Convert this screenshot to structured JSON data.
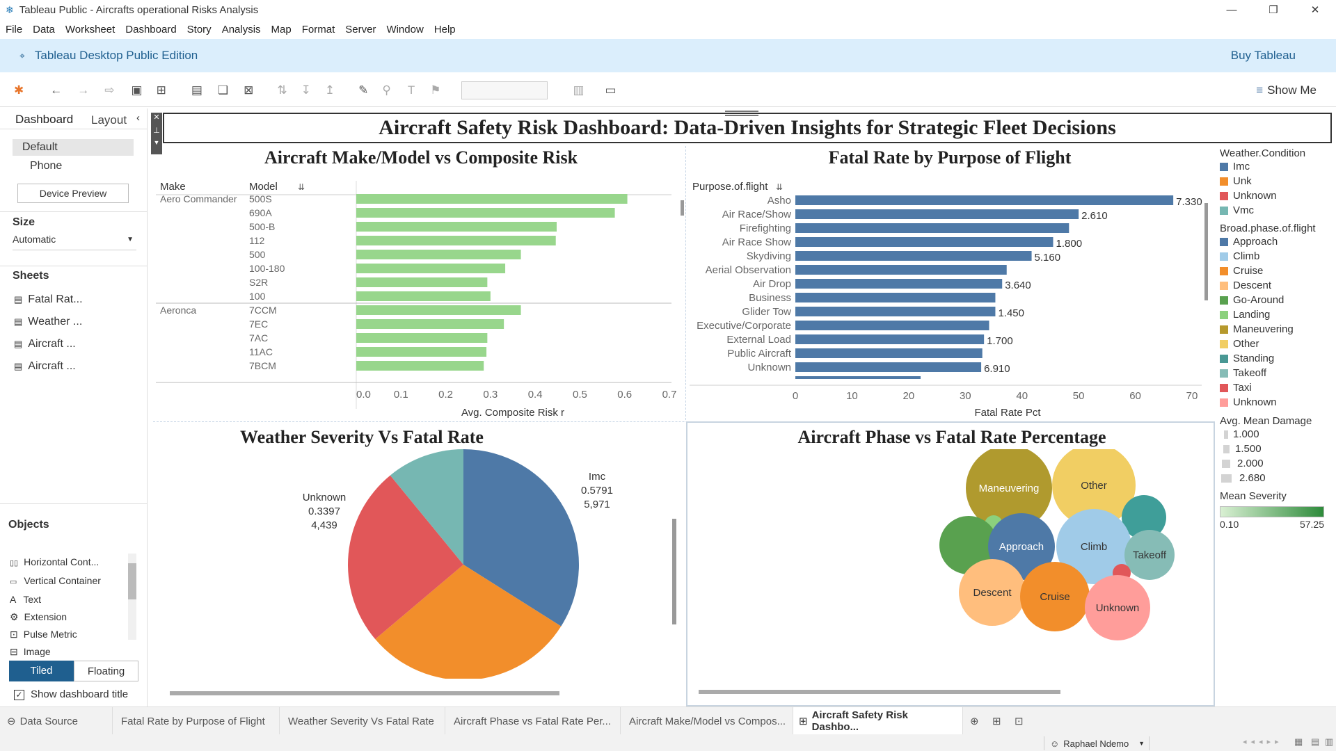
{
  "window": {
    "title": "Tableau Public - Aircrafts operational Risks Analysis",
    "controls": [
      "—",
      "❐",
      "✕"
    ]
  },
  "menu": [
    "File",
    "Data",
    "Worksheet",
    "Dashboard",
    "Story",
    "Analysis",
    "Map",
    "Format",
    "Server",
    "Window",
    "Help"
  ],
  "edition": {
    "label": "Tableau Desktop Public Edition",
    "buy": "Buy Tableau"
  },
  "toolbar": {
    "show_me": "Show Me"
  },
  "left": {
    "tabs": {
      "dashboard": "Dashboard",
      "layout": "Layout"
    },
    "devices": [
      "Default",
      "Phone"
    ],
    "device_preview": "Device Preview",
    "size_title": "Size",
    "size_value": "Automatic",
    "sheets_title": "Sheets",
    "sheets": [
      "Fatal Rat...",
      "Weather ...",
      "Aircraft ...",
      "Aircraft ..."
    ],
    "objects_title": "Objects",
    "objects": [
      "Horizontal Cont...",
      "Vertical Container",
      "Text",
      "Extension",
      "Pulse Metric",
      "Image"
    ],
    "tiled": "Tiled",
    "floating": "Floating",
    "show_title": "Show dashboard title"
  },
  "dashboard": {
    "title": "Aircraft Safety Risk Dashboard: Data-Driven Insights for Strategic Fleet Decisions"
  },
  "chart_data": [
    {
      "type": "bar",
      "title": "Aircraft Make/Model vs Composite Risk",
      "header_make": "Make",
      "header_model": "Model",
      "xlabel": "Avg. Composite Risk r",
      "xlim": [
        0,
        0.7
      ],
      "xticks": [
        "0.0",
        "0.1",
        "0.2",
        "0.3",
        "0.4",
        "0.5",
        "0.6",
        "0.7"
      ],
      "groups": [
        {
          "make": "Aero Commander",
          "models": [
            "500S",
            "690A",
            "500-B",
            "112",
            "500",
            "100-180",
            "S2R",
            "100"
          ],
          "values": [
            0.606,
            0.578,
            0.448,
            0.446,
            0.368,
            0.333,
            0.293,
            0.3
          ]
        },
        {
          "make": "Aeronca",
          "models": [
            "7CCM",
            "7EC",
            "7AC",
            "11AC",
            "7BCM"
          ],
          "values": [
            0.368,
            0.33,
            0.293,
            0.291,
            0.285
          ]
        }
      ]
    },
    {
      "type": "bar",
      "title": "Fatal Rate by Purpose of Flight",
      "header": "Purpose.of.flight",
      "xlabel": "Fatal Rate Pct",
      "xlim": [
        0,
        70
      ],
      "xticks": [
        "0",
        "10",
        "20",
        "30",
        "40",
        "50",
        "60",
        "70"
      ],
      "categories": [
        "Asho",
        "Air Race/Show",
        "Firefighting",
        "Air Race Show",
        "Skydiving",
        "Aerial Observation",
        "Air Drop",
        "Business",
        "Glider Tow",
        "Executive/Corporate",
        "External Load",
        "Public Aircraft",
        "Unknown"
      ],
      "values": [
        66.7,
        50,
        48.3,
        45.5,
        41.7,
        37.3,
        36.5,
        35.3,
        35.3,
        34.2,
        33.3,
        33.0,
        32.8
      ],
      "labels": [
        "7.330",
        "2.610",
        "",
        "1.800",
        "5.160",
        "",
        "3.640",
        "",
        "1.450",
        "",
        "1.700",
        "",
        "6.910"
      ]
    },
    {
      "type": "pie",
      "title": "Weather Severity Vs Fatal Rate",
      "slices": [
        {
          "name": "Imc",
          "value": 5971,
          "rate": "0.5791",
          "count": "5,971",
          "color": "#4e79a7"
        },
        {
          "name": "Unk",
          "value": 5250,
          "color": "#f28e2b"
        },
        {
          "name": "Unknown",
          "value": 4439,
          "rate": "0.3397",
          "count": "4,439",
          "color": "#e15759"
        },
        {
          "name": "Vmc",
          "value": 1920,
          "color": "#76b7b2"
        }
      ]
    },
    {
      "type": "scatter",
      "title": "Aircraft Phase vs Fatal Rate Percentage",
      "bubbles": [
        {
          "name": "Maneuvering",
          "color": "#b09a2e",
          "label": "Maneuvering"
        },
        {
          "name": "Other",
          "color": "#f1ce63",
          "label": "Other"
        },
        {
          "name": "Standing",
          "color": "#3f9e99",
          "label": ""
        },
        {
          "name": "Landing",
          "color": "#8cd17d",
          "label": ""
        },
        {
          "name": "Go-Around",
          "color": "#59a14f",
          "label": ""
        },
        {
          "name": "Approach",
          "color": "#4e79a7",
          "label": "Approach"
        },
        {
          "name": "Climb",
          "color": "#a0cbe8",
          "label": "Climb"
        },
        {
          "name": "Takeoff",
          "color": "#86bcb6",
          "label": "Takeoff"
        },
        {
          "name": "Taxi",
          "color": "#e15759",
          "label": ""
        },
        {
          "name": "Descent",
          "color": "#ffbe7d",
          "label": "Descent"
        },
        {
          "name": "Cruise",
          "color": "#f28e2b",
          "label": "Cruise"
        },
        {
          "name": "Unknown",
          "color": "#ff9d9a",
          "label": "Unknown"
        }
      ]
    }
  ],
  "legends": {
    "weather_title": "Weather.Condition",
    "weather": [
      {
        "name": "Imc",
        "color": "#4e79a7"
      },
      {
        "name": "Unk",
        "color": "#f28e2b"
      },
      {
        "name": "Unknown",
        "color": "#e15759"
      },
      {
        "name": "Vmc",
        "color": "#76b7b2"
      }
    ],
    "phase_title": "Broad.phase.of.flight",
    "phase": [
      {
        "name": "Approach",
        "color": "#4e79a7"
      },
      {
        "name": "Climb",
        "color": "#a0cbe8"
      },
      {
        "name": "Cruise",
        "color": "#f28e2b"
      },
      {
        "name": "Descent",
        "color": "#ffbe7d"
      },
      {
        "name": "Go-Around",
        "color": "#59a14f"
      },
      {
        "name": "Landing",
        "color": "#8cd17d"
      },
      {
        "name": "Maneuvering",
        "color": "#b6992d"
      },
      {
        "name": "Other",
        "color": "#f1ce63"
      },
      {
        "name": "Standing",
        "color": "#499894"
      },
      {
        "name": "Takeoff",
        "color": "#86bcb6"
      },
      {
        "name": "Taxi",
        "color": "#e15759"
      },
      {
        "name": "Unknown",
        "color": "#ff9d9a"
      }
    ],
    "damage_title": "Avg. Mean Damage",
    "damage": [
      "1.000",
      "1.500",
      "2.000",
      "2.680"
    ],
    "severity_title": "Mean Severity",
    "severity_min": "0.10",
    "severity_max": "57.25"
  },
  "bottom_tabs": [
    "Data Source",
    "Fatal Rate by Purpose of Flight",
    "Weather Severity Vs Fatal Rate",
    "Aircraft Phase vs Fatal Rate Per...",
    "Aircraft Make/Model vs Compos...",
    "Aircraft Safety Risk Dashbo..."
  ],
  "status": {
    "user": "Raphael Ndemo"
  }
}
